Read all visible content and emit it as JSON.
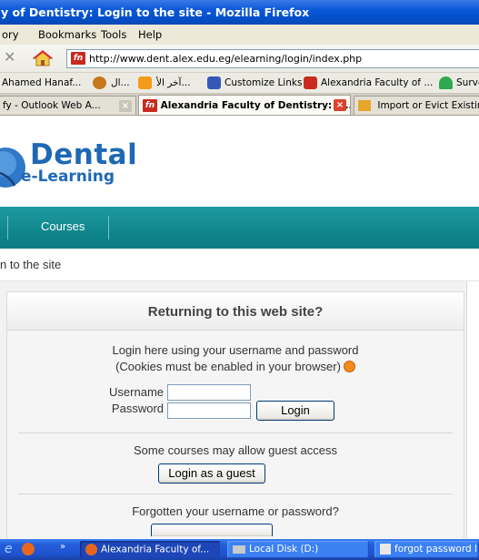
{
  "window": {
    "title": "y of Dentistry: Login to the site - Mozilla Firefox"
  },
  "menu": {
    "items": [
      "ory",
      "Bookmarks",
      "Tools",
      "Help"
    ]
  },
  "navigation": {
    "url": "http://www.dent.alex.edu.eg/elearning/login/index.php"
  },
  "bookmarks": {
    "items": [
      "Ahamed Hanaf...",
      "ال...",
      "آخر الأ...",
      "Customize Links",
      "Alexandria Faculty of ...",
      "Surve"
    ]
  },
  "tabs": [
    {
      "label": "fy - Outlook Web A...",
      "active": false
    },
    {
      "label": "Alexandria Faculty of Dentistry: L...",
      "active": true
    },
    {
      "label": "Import or Evict Existin",
      "active": false
    }
  ],
  "site": {
    "logo_line1": "Dental",
    "logo_line2": "e-Learning",
    "nav_courses": "Courses",
    "breadcrumb": "n to the site"
  },
  "login": {
    "heading": "Returning to this web site?",
    "intro_line1": "Login here using your username and password",
    "intro_line2": "(Cookies must be enabled in your browser)",
    "username_label": "Username",
    "password_label": "Password",
    "username_value": "",
    "password_value": "",
    "login_button": "Login",
    "guest_text": "Some courses may allow guest access",
    "guest_button": "Login as a guest",
    "forgot_text": "Forgotten your username or password?"
  },
  "taskbar": {
    "items": [
      {
        "label": "Alexandria Faculty of...",
        "active": true
      },
      {
        "label": "Local Disk (D:)",
        "active": false
      },
      {
        "label": "forgot password l",
        "active": false
      }
    ]
  },
  "colors": {
    "teal_nav": "#0f868c",
    "logo_blue": "#1e68b5",
    "xp_title_blue": "#0a58d8"
  }
}
